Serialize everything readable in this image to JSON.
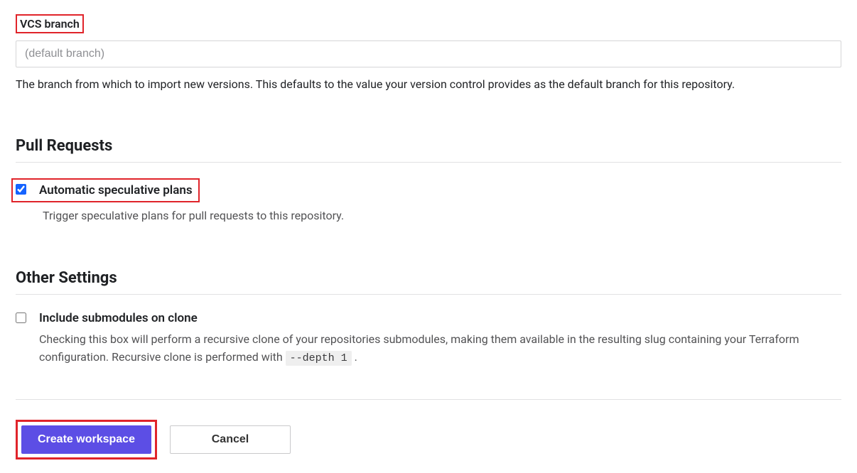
{
  "vcs": {
    "label": "VCS branch",
    "placeholder": "(default branch)",
    "value": "",
    "help": "The branch from which to import new versions. This defaults to the value your version control provides as the default branch for this repository."
  },
  "pullRequests": {
    "heading": "Pull Requests",
    "speculative": {
      "title": "Automatic speculative plans",
      "desc": "Trigger speculative plans for pull requests to this repository.",
      "checked": true
    }
  },
  "otherSettings": {
    "heading": "Other Settings",
    "submodules": {
      "title": "Include submodules on clone",
      "descPart1": "Checking this box will perform a recursive clone of your repositories submodules, making them available in the resulting slug containing your Terraform configuration. Recursive clone is performed with ",
      "code": "--depth 1",
      "descPart2": " .",
      "checked": false
    }
  },
  "buttons": {
    "create": "Create workspace",
    "cancel": "Cancel"
  }
}
